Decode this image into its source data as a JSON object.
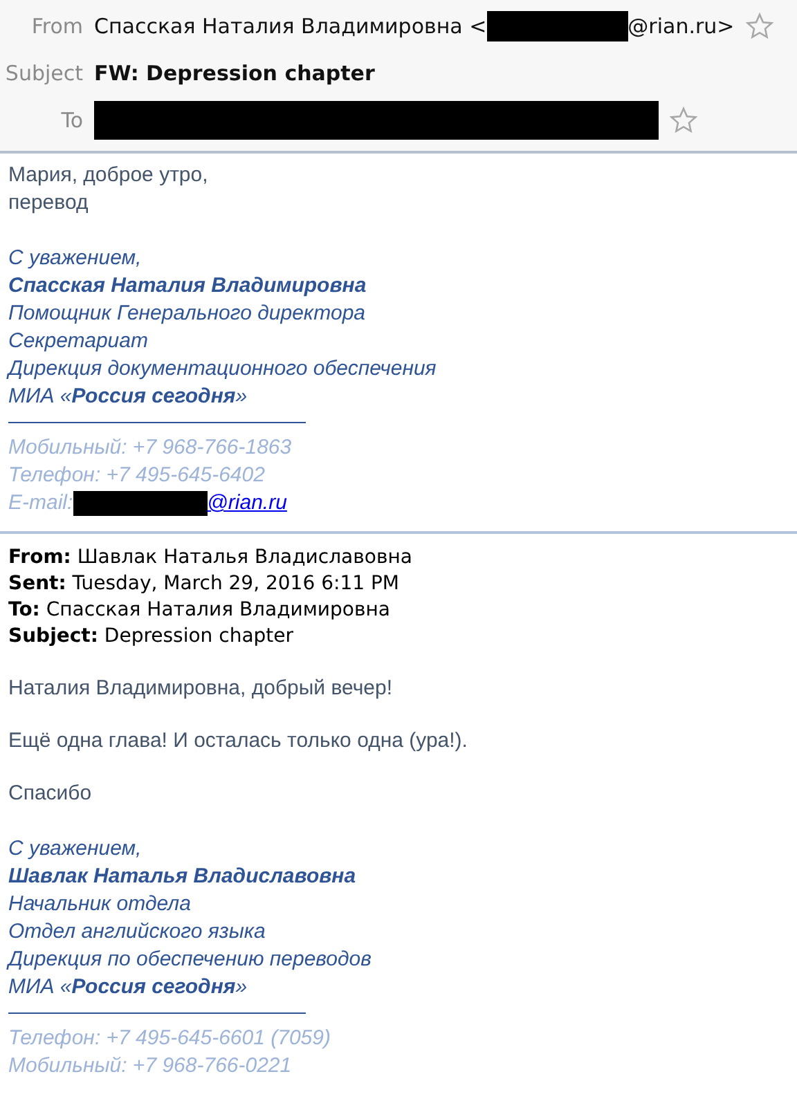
{
  "header": {
    "from": {
      "label": "From",
      "name": "Спасская Наталия Владимировна <",
      "address_suffix": "@rian.ru>",
      "starred": false
    },
    "subject": {
      "label": "Subject",
      "value": "FW: Depression chapter"
    },
    "to": {
      "label": "To",
      "starred": false
    }
  },
  "message": {
    "paragraphs": [
      "Мария, доброе утро,\nперевод"
    ],
    "signature": {
      "lines": [
        {
          "kind": "plain",
          "text": "С уважением,"
        },
        {
          "kind": "name",
          "text": "Спасская Наталия Владимировна"
        },
        {
          "kind": "plain",
          "text": "Помощник Генерального директора"
        },
        {
          "kind": "plain",
          "text": "Секретариат"
        },
        {
          "kind": "plain",
          "text": "Дирекция документационного обеспечения"
        },
        {
          "kind": "rich",
          "text": "МИА «**Россия сегодня**»"
        }
      ],
      "contacts": [
        {
          "kind": "plain",
          "text": "Мобильный: +7 968-766-1863"
        },
        {
          "kind": "plain",
          "text": "Телефон: +7 495-645-6402"
        },
        {
          "kind": "email",
          "text": "E-mail:",
          "link": "@rian.ru"
        }
      ]
    }
  },
  "quoted": {
    "fields": [
      {
        "label": "From:",
        "value": "Шавлак Наталья Владиславовна"
      },
      {
        "label": "Sent:",
        "value": "Tuesday, March 29, 2016 6:11 PM"
      },
      {
        "label": "To:",
        "value": "Спасская Наталия Владимировна"
      },
      {
        "label": "Subject:",
        "value": "Depression chapter"
      }
    ],
    "paragraphs": [
      "Наталия Владимировна, добрый вечер!",
      "Ещё одна глава! И осталась только одна (ура!).",
      "Спасибо"
    ],
    "signature": {
      "lines": [
        {
          "kind": "plain",
          "text": "С уважением,"
        },
        {
          "kind": "name",
          "text": "Шавлак Наталья Владиславовна"
        },
        {
          "kind": "plain",
          "text": "Начальник отдела"
        },
        {
          "kind": "plain",
          "text": "Отдел английского языка"
        },
        {
          "kind": "plain",
          "text": "Дирекция по обеспечению переводов"
        },
        {
          "kind": "rich",
          "text": "МИА «**Россия сегодня**»"
        }
      ],
      "contacts": [
        {
          "kind": "plain",
          "text": "Телефон: +7 495-645-6601 (7059)"
        },
        {
          "kind": "plain",
          "text": "Мобильный: +7 968-766-0221"
        }
      ]
    }
  }
}
